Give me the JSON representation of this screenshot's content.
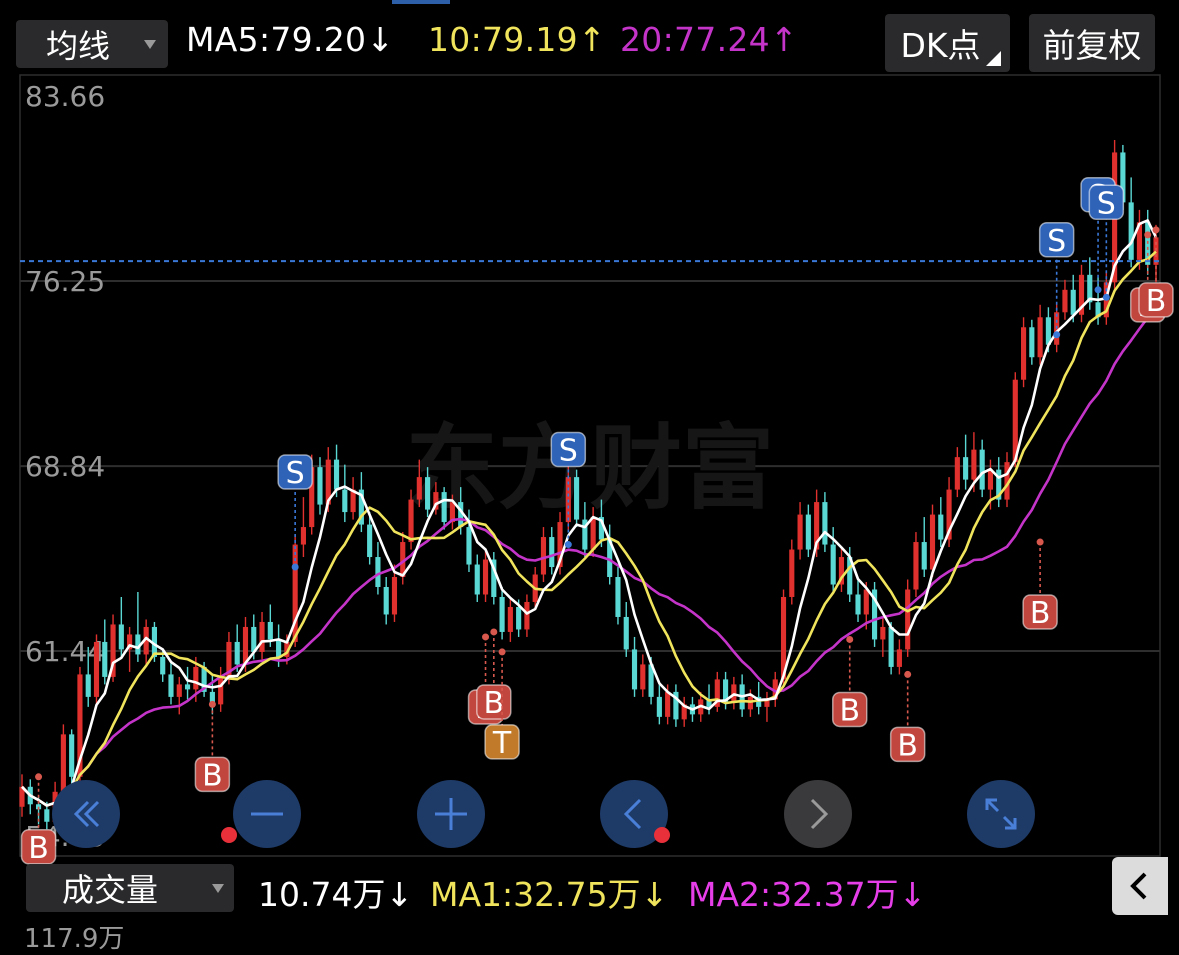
{
  "header": {
    "indicator_select": "均线",
    "ma5": {
      "text": "MA5:79.20↓",
      "color": "#ffffff"
    },
    "ma10": {
      "text": "10:79.19↑",
      "color": "#f0e45c"
    },
    "ma20": {
      "text": "20:77.24↑",
      "color": "#c434c8"
    },
    "dk_button": "DK点",
    "adjust_button": "前复权"
  },
  "colors": {
    "up": "#e0312e",
    "down": "#5ad8d4",
    "ma5": "#ffffff",
    "ma10": "#f0e45c",
    "ma20": "#c434c8",
    "signal_b": "#c0463e",
    "signal_s": "#2e63b8",
    "signal_t": "#c07a2a",
    "gridline": "#2e2e2e",
    "dashed_price": "#3a78d8"
  },
  "chart_data": {
    "type": "candlestick",
    "y_ticks": [
      "83.66",
      "76.25",
      "68.84",
      "61.44",
      "54.03"
    ],
    "ylim": [
      54.03,
      83.66
    ],
    "last_price_line": 77.05,
    "watermark": "东方财富",
    "candles": [
      [
        55.2,
        56.5,
        54.8,
        56.0
      ],
      [
        56.0,
        56.3,
        54.9,
        55.3
      ],
      [
        55.3,
        55.6,
        54.5,
        55.1
      ],
      [
        55.1,
        55.4,
        54.3,
        54.6
      ],
      [
        54.6,
        56.2,
        54.4,
        55.8
      ],
      [
        55.8,
        58.5,
        55.5,
        58.1
      ],
      [
        58.1,
        58.3,
        56.0,
        56.4
      ],
      [
        56.4,
        60.8,
        56.2,
        60.5
      ],
      [
        60.5,
        61.6,
        59.2,
        59.6
      ],
      [
        59.6,
        62.1,
        59.3,
        61.8
      ],
      [
        61.8,
        62.7,
        60.1,
        60.4
      ],
      [
        60.4,
        62.9,
        60.2,
        62.5
      ],
      [
        62.5,
        63.6,
        61.2,
        61.5
      ],
      [
        61.5,
        62.4,
        60.6,
        62.1
      ],
      [
        62.1,
        63.8,
        61.0,
        61.3
      ],
      [
        61.3,
        62.7,
        60.8,
        62.4
      ],
      [
        62.4,
        62.6,
        61.0,
        61.2
      ],
      [
        61.2,
        61.5,
        60.2,
        60.5
      ],
      [
        60.5,
        61.0,
        59.3,
        59.6
      ],
      [
        59.6,
        60.4,
        58.9,
        60.1
      ],
      [
        60.1,
        60.8,
        59.5,
        59.9
      ],
      [
        59.9,
        61.2,
        59.4,
        60.8
      ],
      [
        60.8,
        61.0,
        59.6,
        59.8
      ],
      [
        59.8,
        60.5,
        58.9,
        59.3
      ],
      [
        59.3,
        60.8,
        59.0,
        60.4
      ],
      [
        60.4,
        62.2,
        60.1,
        61.8
      ],
      [
        61.8,
        62.5,
        60.6,
        60.9
      ],
      [
        60.9,
        62.8,
        60.6,
        62.4
      ],
      [
        62.4,
        62.9,
        61.1,
        61.4
      ],
      [
        61.4,
        63.0,
        61.1,
        62.6
      ],
      [
        62.6,
        63.3,
        61.6,
        61.9
      ],
      [
        61.9,
        62.5,
        60.8,
        61.2
      ],
      [
        61.2,
        62.1,
        60.9,
        61.8
      ],
      [
        61.8,
        66.1,
        61.6,
        65.7
      ],
      [
        65.7,
        67.6,
        65.2,
        66.4
      ],
      [
        66.4,
        69.3,
        66.1,
        68.8
      ],
      [
        68.8,
        69.2,
        66.9,
        67.3
      ],
      [
        67.3,
        69.6,
        67.0,
        69.1
      ],
      [
        69.1,
        69.7,
        67.6,
        67.9
      ],
      [
        67.9,
        68.9,
        66.6,
        67.0
      ],
      [
        67.0,
        68.4,
        66.7,
        67.9
      ],
      [
        67.9,
        68.6,
        66.2,
        66.5
      ],
      [
        66.5,
        67.0,
        64.9,
        65.2
      ],
      [
        65.2,
        65.8,
        63.7,
        64.0
      ],
      [
        64.0,
        64.4,
        62.5,
        62.9
      ],
      [
        62.9,
        64.9,
        62.6,
        64.4
      ],
      [
        64.4,
        66.2,
        64.1,
        65.8
      ],
      [
        65.8,
        67.9,
        65.5,
        67.5
      ],
      [
        67.5,
        69.1,
        67.2,
        68.4
      ],
      [
        68.4,
        68.8,
        66.8,
        67.1
      ],
      [
        67.1,
        68.2,
        66.9,
        67.8
      ],
      [
        67.8,
        68.0,
        66.3,
        66.6
      ],
      [
        66.6,
        67.7,
        66.3,
        67.4
      ],
      [
        67.4,
        68.0,
        66.1,
        66.4
      ],
      [
        66.4,
        67.1,
        64.6,
        64.9
      ],
      [
        64.9,
        65.3,
        63.4,
        63.7
      ],
      [
        63.7,
        65.5,
        63.4,
        65.1
      ],
      [
        65.1,
        65.4,
        63.3,
        63.6
      ],
      [
        63.6,
        64.0,
        61.9,
        62.2
      ],
      [
        62.2,
        63.6,
        61.8,
        63.2
      ],
      [
        63.2,
        63.5,
        62.0,
        62.3
      ],
      [
        62.3,
        63.7,
        62.0,
        63.4
      ],
      [
        63.4,
        64.8,
        63.1,
        64.5
      ],
      [
        64.5,
        66.4,
        64.2,
        66.0
      ],
      [
        66.0,
        66.4,
        64.5,
        64.8
      ],
      [
        64.8,
        67.0,
        64.5,
        66.6
      ],
      [
        66.6,
        68.9,
        66.3,
        68.4
      ],
      [
        68.4,
        68.7,
        66.4,
        66.7
      ],
      [
        66.7,
        67.4,
        65.2,
        65.5
      ],
      [
        65.5,
        67.2,
        65.2,
        66.8
      ],
      [
        66.8,
        67.5,
        65.6,
        65.9
      ],
      [
        65.9,
        66.5,
        64.1,
        64.4
      ],
      [
        64.4,
        64.8,
        62.5,
        62.8
      ],
      [
        62.8,
        63.4,
        61.2,
        61.5
      ],
      [
        61.5,
        62.0,
        59.6,
        59.9
      ],
      [
        59.9,
        61.3,
        59.6,
        60.9
      ],
      [
        60.9,
        61.2,
        59.3,
        59.6
      ],
      [
        59.6,
        60.2,
        58.5,
        58.8
      ],
      [
        58.8,
        60.1,
        58.5,
        59.8
      ],
      [
        59.8,
        60.1,
        58.4,
        58.7
      ],
      [
        58.7,
        59.6,
        58.4,
        59.3
      ],
      [
        59.3,
        59.6,
        58.6,
        58.9
      ],
      [
        58.9,
        59.8,
        58.6,
        59.5
      ],
      [
        59.5,
        60.1,
        58.9,
        59.2
      ],
      [
        59.2,
        60.6,
        59.0,
        60.3
      ],
      [
        60.3,
        60.6,
        59.1,
        59.4
      ],
      [
        59.4,
        60.4,
        59.1,
        60.1
      ],
      [
        60.1,
        60.5,
        58.8,
        59.1
      ],
      [
        59.1,
        59.9,
        58.8,
        59.6
      ],
      [
        59.6,
        60.2,
        58.9,
        59.2
      ],
      [
        59.2,
        59.8,
        58.6,
        59.5
      ],
      [
        59.5,
        60.6,
        59.2,
        60.3
      ],
      [
        60.3,
        63.9,
        60.0,
        63.6
      ],
      [
        63.6,
        65.9,
        63.3,
        65.5
      ],
      [
        65.5,
        67.4,
        65.1,
        66.9
      ],
      [
        66.9,
        67.3,
        65.2,
        65.5
      ],
      [
        65.5,
        67.9,
        65.2,
        67.4
      ],
      [
        67.4,
        67.8,
        65.4,
        65.7
      ],
      [
        65.7,
        66.4,
        63.8,
        64.1
      ],
      [
        64.1,
        65.6,
        63.8,
        65.2
      ],
      [
        65.2,
        65.6,
        63.4,
        63.7
      ],
      [
        63.7,
        64.3,
        62.6,
        62.9
      ],
      [
        62.9,
        64.2,
        62.3,
        63.9
      ],
      [
        63.9,
        64.2,
        61.6,
        61.9
      ],
      [
        61.9,
        62.8,
        61.2,
        62.4
      ],
      [
        62.4,
        62.6,
        60.5,
        60.8
      ],
      [
        60.8,
        61.9,
        60.5,
        61.5
      ],
      [
        61.5,
        64.3,
        61.2,
        63.9
      ],
      [
        63.9,
        66.2,
        63.6,
        65.8
      ],
      [
        65.8,
        66.8,
        64.4,
        64.7
      ],
      [
        64.7,
        67.3,
        64.4,
        66.9
      ],
      [
        66.9,
        67.6,
        65.6,
        65.9
      ],
      [
        65.9,
        68.4,
        65.6,
        67.9
      ],
      [
        67.9,
        69.6,
        67.6,
        69.2
      ],
      [
        69.2,
        70.1,
        67.9,
        68.3
      ],
      [
        68.3,
        70.2,
        67.8,
        69.5
      ],
      [
        69.5,
        69.9,
        67.6,
        67.9
      ],
      [
        67.9,
        69.1,
        67.1,
        68.7
      ],
      [
        68.7,
        69.2,
        67.2,
        67.5
      ],
      [
        67.5,
        69.4,
        67.2,
        69.0
      ],
      [
        69.0,
        72.6,
        68.8,
        72.3
      ],
      [
        72.3,
        74.8,
        72.0,
        74.4
      ],
      [
        74.4,
        74.7,
        72.9,
        73.2
      ],
      [
        73.2,
        75.3,
        72.9,
        74.8
      ],
      [
        74.8,
        75.2,
        73.4,
        73.7
      ],
      [
        73.7,
        75.4,
        73.4,
        75.0
      ],
      [
        75.0,
        76.3,
        74.7,
        75.9
      ],
      [
        75.9,
        76.5,
        74.6,
        74.9
      ],
      [
        74.9,
        76.9,
        74.6,
        76.5
      ],
      [
        76.5,
        77.2,
        75.1,
        75.4
      ],
      [
        75.4,
        76.4,
        74.5,
        74.8
      ],
      [
        74.8,
        76.6,
        74.5,
        76.2
      ],
      [
        76.2,
        81.9,
        75.9,
        81.4
      ],
      [
        81.4,
        81.7,
        79.1,
        79.4
      ],
      [
        79.4,
        80.4,
        76.8,
        77.1
      ],
      [
        77.1,
        79.1,
        76.7,
        78.6
      ],
      [
        78.6,
        79.1,
        76.5,
        76.9
      ],
      [
        76.9,
        78.5,
        76.2,
        78.0
      ]
    ],
    "signals": [
      {
        "label": "B",
        "index": 2,
        "price": 56.4
      },
      {
        "label": "B",
        "index": 23,
        "price": 59.3
      },
      {
        "label": "S",
        "index": 33,
        "price": 64.8
      },
      {
        "label": "B",
        "index": 56,
        "price": 62.0
      },
      {
        "label": "B",
        "index": 57,
        "price": 62.2
      },
      {
        "label": "T",
        "index": 58,
        "price": 61.4
      },
      {
        "label": "S",
        "index": 66,
        "price": 65.7
      },
      {
        "label": "B",
        "index": 100,
        "price": 61.9
      },
      {
        "label": "B",
        "index": 107,
        "price": 60.5
      },
      {
        "label": "B",
        "index": 123,
        "price": 65.8
      },
      {
        "label": "S",
        "index": 125,
        "price": 74.1
      },
      {
        "label": "S",
        "index": 130,
        "price": 75.9
      },
      {
        "label": "S",
        "index": 131,
        "price": 75.6
      },
      {
        "label": "B",
        "index": 136,
        "price": 78.1
      },
      {
        "label": "B",
        "index": 137,
        "price": 78.3
      }
    ]
  },
  "volume": {
    "indicator_select": "成交量",
    "current": {
      "text": "10.74万↓",
      "color": "#ffffff"
    },
    "ma1": {
      "text": "MA1:32.75万↓",
      "color": "#f0e45c"
    },
    "ma2": {
      "text": "MA2:32.37万↓",
      "color": "#e63ee8"
    },
    "max_label": "117.9万"
  }
}
